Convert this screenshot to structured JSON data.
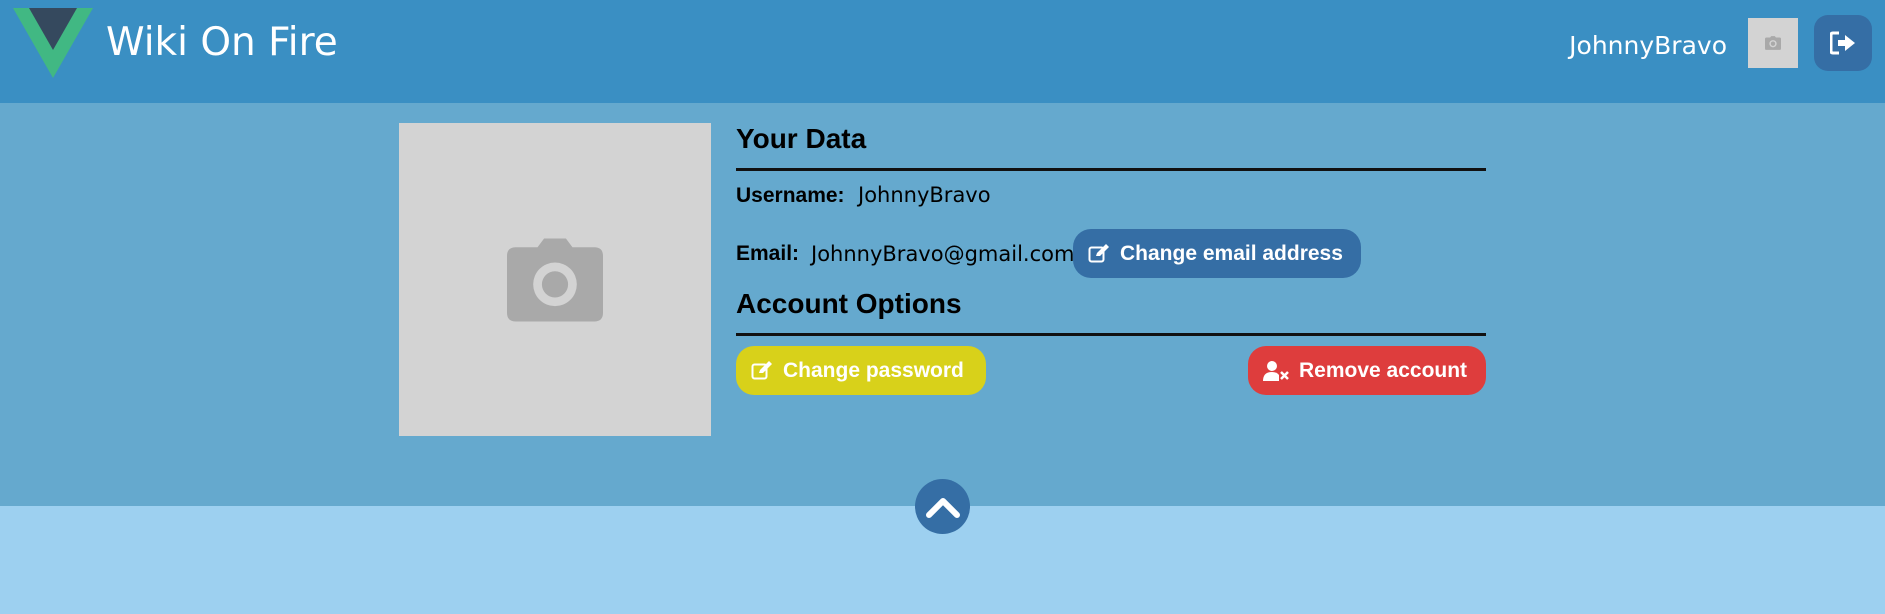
{
  "header": {
    "app_title": "Wiki On Fire",
    "username": "JohnnyBravo",
    "avatar_icon": "camera-icon",
    "logout_icon": "sign-out-icon"
  },
  "profile": {
    "photo_icon": "camera-icon",
    "your_data_title": "Your Data",
    "username_label": "Username:",
    "username_value": "JohnnyBravo",
    "email_label": "Email:",
    "email_value": "JohnnyBravo@gmail.com",
    "change_email_label": "Change email address",
    "account_options_title": "Account Options",
    "change_password_label": "Change password",
    "remove_account_label": "Remove account"
  },
  "scroll_top_icon": "chevron-up-icon",
  "colors": {
    "header_bg": "#3a8fc3",
    "panel_bg": "#65a9ce",
    "page_bg": "#9dd0f0",
    "primary": "#356ea5",
    "warning": "#d8d11a",
    "danger": "#de3d3d",
    "logo_green": "#41b883",
    "logo_dark": "#35495e"
  }
}
